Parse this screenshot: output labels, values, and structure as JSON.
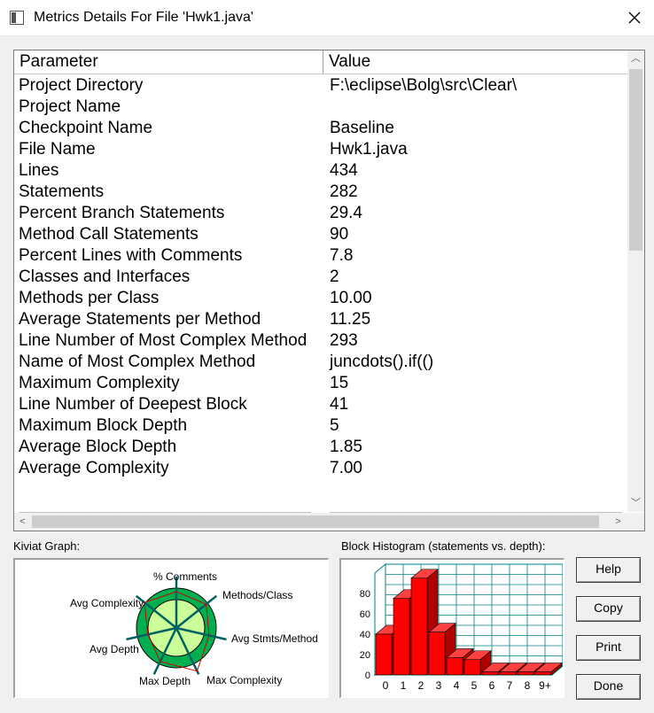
{
  "window": {
    "title": "Metrics Details For File 'Hwk1.java'"
  },
  "table": {
    "headers": {
      "parameter": "Parameter",
      "value": "Value"
    },
    "rows": [
      {
        "p": "Project Directory",
        "v": "F:\\eclipse\\Bolg\\src\\Clear\\"
      },
      {
        "p": "Project Name",
        "v": ""
      },
      {
        "p": "Checkpoint Name",
        "v": "Baseline"
      },
      {
        "p": "File Name",
        "v": "Hwk1.java"
      },
      {
        "p": "Lines",
        "v": "434"
      },
      {
        "p": "Statements",
        "v": "282"
      },
      {
        "p": "Percent Branch Statements",
        "v": "29.4"
      },
      {
        "p": "Method Call Statements",
        "v": "90"
      },
      {
        "p": "Percent Lines with Comments",
        "v": "7.8"
      },
      {
        "p": "Classes and Interfaces",
        "v": "2"
      },
      {
        "p": "Methods per Class",
        "v": "10.00"
      },
      {
        "p": "Average Statements per Method",
        "v": "11.25"
      },
      {
        "p": "Line Number of Most Complex Method",
        "v": "293"
      },
      {
        "p": "Name of Most Complex Method",
        "v": "juncdots().if(()"
      },
      {
        "p": "Maximum Complexity",
        "v": "15"
      },
      {
        "p": "Line Number of Deepest Block",
        "v": "41"
      },
      {
        "p": "Maximum Block Depth",
        "v": "5"
      },
      {
        "p": "Average Block Depth",
        "v": "1.85"
      },
      {
        "p": "Average Complexity",
        "v": "7.00"
      }
    ],
    "divider_left": "__________________________________",
    "divider_right": "__________________________________"
  },
  "kiviat": {
    "label": "Kiviat Graph:",
    "axes": [
      "% Comments",
      "Methods/Class",
      "Avg Stmts/Method",
      "Max Complexity",
      "Max Depth",
      "Avg Depth",
      "Avg Complexity"
    ]
  },
  "histogram": {
    "label": "Block Histogram (statements vs. depth):",
    "y_ticks": [
      "0",
      "20",
      "40",
      "60",
      "80"
    ],
    "x_labels": [
      "0",
      "1",
      "2",
      "3",
      "4",
      "5",
      "6",
      "7",
      "8",
      "9+"
    ]
  },
  "chart_data": {
    "type": "bar",
    "categories": [
      "0",
      "1",
      "2",
      "3",
      "4",
      "5",
      "6",
      "7",
      "8",
      "9+"
    ],
    "values": [
      40,
      75,
      95,
      42,
      17,
      15,
      3,
      3,
      3,
      3
    ],
    "title": "Block Histogram (statements vs. depth):",
    "xlabel": "",
    "ylabel": "",
    "ylim": [
      0,
      100
    ],
    "grid": true,
    "bar_color": "#ff0000"
  },
  "buttons": {
    "help": "Help",
    "copy": "Copy",
    "print": "Print",
    "done": "Done"
  }
}
